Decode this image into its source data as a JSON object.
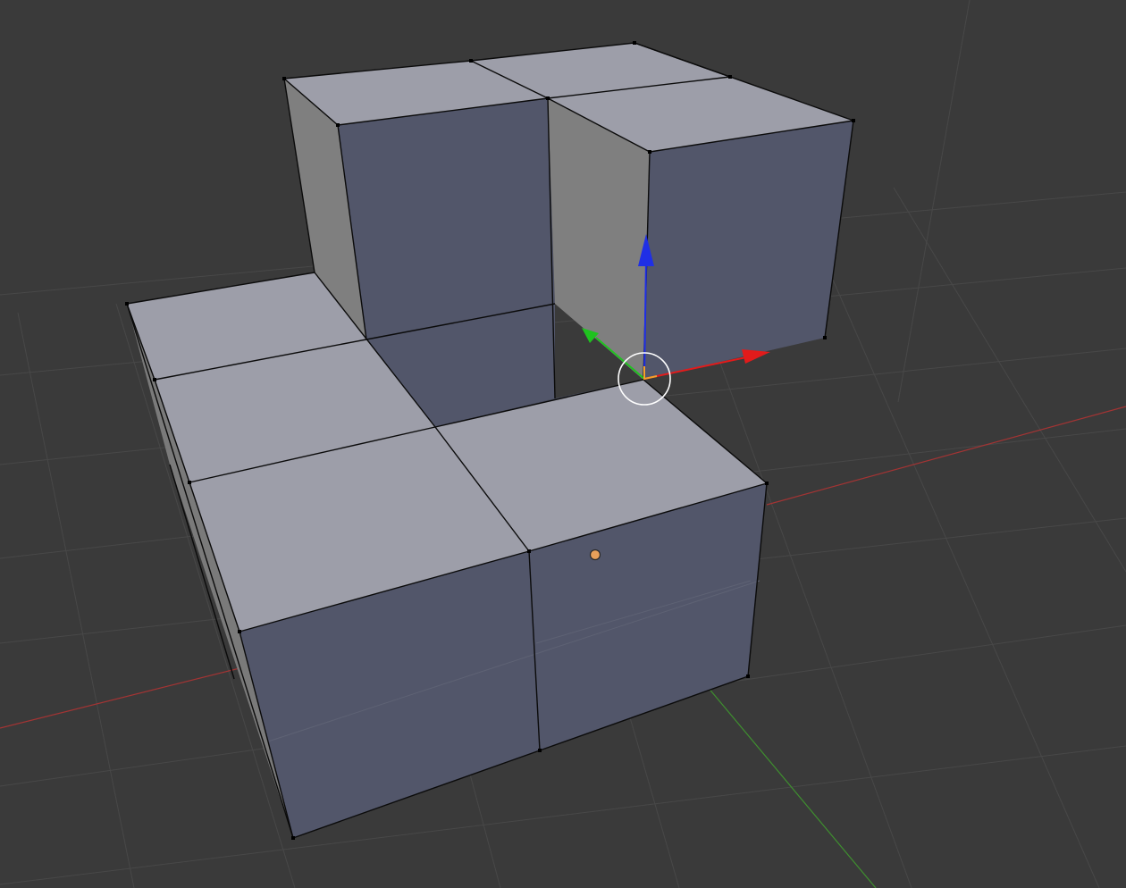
{
  "viewport": {
    "mode": "edit-mode",
    "background": "#3a3a3a",
    "grid_color": "#484848",
    "x_axis_color": "#a33434",
    "y_axis_color": "#3f8f2f"
  },
  "materials": {
    "top_face": "#9d9ea9",
    "front_face": "#52566a",
    "side_face": "#7f7f7f",
    "edge": "#0b0b0b"
  },
  "gizmo": {
    "x_color": "#e21b1b",
    "y_color": "#1fc21f",
    "z_color": "#1f2fe6",
    "origin_color": "#f5a12a",
    "cursor_color": "#ffffff"
  },
  "object_origin_color": "#e8a05a"
}
